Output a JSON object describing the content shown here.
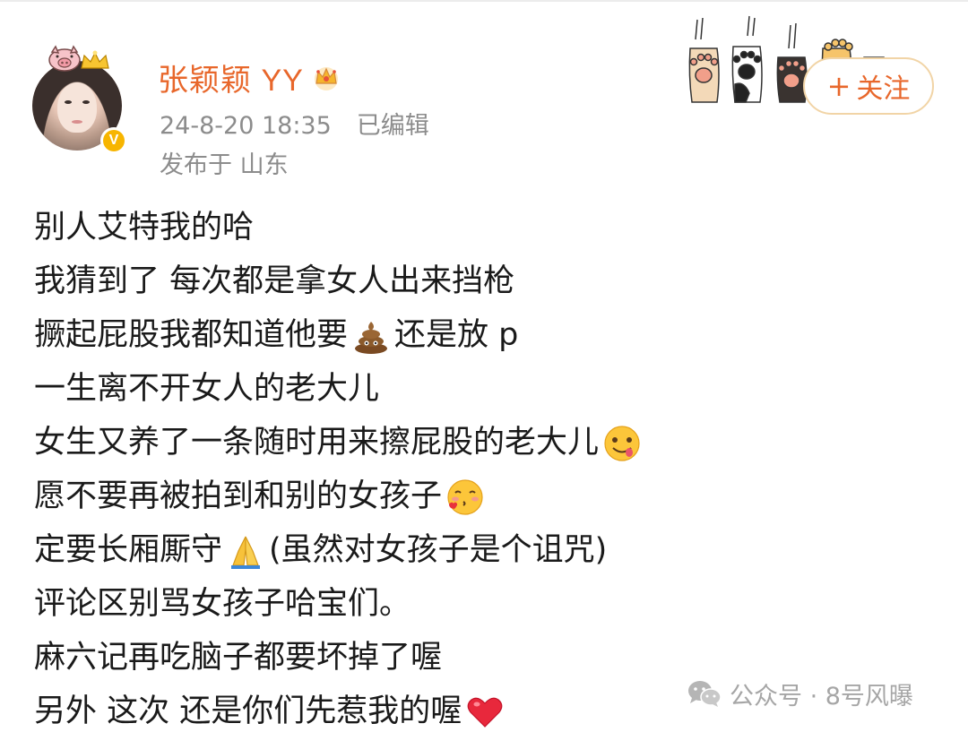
{
  "post": {
    "author": {
      "name": "张颖颖 YY",
      "verified": true,
      "verified_mark": "V",
      "avatar_icon": "user-avatar",
      "badge_icon": "crown-icon"
    },
    "timestamp": "24-8-20 18:35",
    "edited_label": "已编辑",
    "location": "发布于 山东",
    "follow_button": {
      "plus": "+",
      "label": "关注"
    },
    "lines": [
      {
        "text": "别人艾特我的哈"
      },
      {
        "text": "我猜到了 每次都是拿女人出来挡枪"
      },
      {
        "before": "撅起屁股我都知道他要",
        "emoji": "poop-emoji",
        "after": "还是放 p"
      },
      {
        "text": "一生离不开女人的老大儿"
      },
      {
        "before": "女生又养了一条随时用来擦屁股的老大儿",
        "emoji": "yum-face-emoji",
        "after": ""
      },
      {
        "before": "愿不要再被拍到和别的女孩子",
        "emoji": "blowing-kiss-emoji",
        "after": ""
      },
      {
        "before": "定要长厢厮守",
        "emoji": "folded-hands-emoji",
        "after": "(虽然对女孩子是个诅咒)"
      },
      {
        "text": "评论区别骂女孩子哈宝们。"
      },
      {
        "text": "麻六记再吃脑子都要坏掉了喔"
      },
      {
        "before": "另外 这次 还是你们先惹我的喔",
        "emoji": "red-heart-emoji",
        "after": ""
      }
    ]
  },
  "watermark": {
    "icon": "wechat-icon",
    "text": "公众号 · 8号风曝"
  },
  "colors": {
    "username": "#e8672b",
    "meta": "#8c8c8c",
    "follow_border": "#f1d4a6",
    "verified": "#f7b500"
  }
}
